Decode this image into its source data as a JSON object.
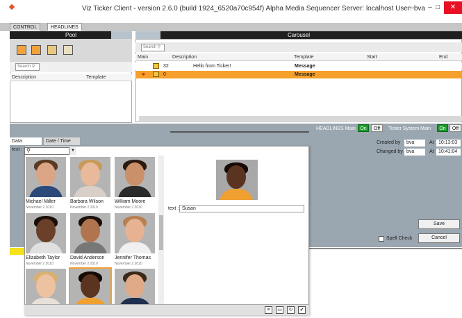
{
  "window": {
    "title": "Viz Ticker Client - version 2.6.0 (build 1924_6520a70c954f) Alpha    Media Sequencer Server: localhost   User: bva",
    "controls": [
      "↔",
      "–",
      "□",
      "✕"
    ]
  },
  "tabs": [
    "CONTROL",
    "HEADLINES"
  ],
  "pool": {
    "title": "Pool",
    "search_placeholder": "Search",
    "columns": [
      "Description",
      "Template"
    ]
  },
  "carousel": {
    "title": "Carousel",
    "search_placeholder": "Search",
    "columns": [
      "Main",
      "Description",
      "Template",
      "Start",
      "End"
    ],
    "rows": [
      {
        "count": "32",
        "description": "Hello from Ticker!",
        "template": "Message"
      },
      {
        "count": "0",
        "description": "",
        "template": "Message"
      }
    ]
  },
  "controls_bar": {
    "headlines_main_label": "HEADLINES Main",
    "ticker_main_label": "Ticker System Main",
    "on_label": "On",
    "off_label": "Off"
  },
  "editor": {
    "tabs": [
      "Data",
      "Date / Time"
    ],
    "field_label": "text :",
    "text_value": "Susan",
    "created_by_label": "Created by",
    "created_by": "bva",
    "changed_by_label": "Changed by",
    "changed_by": "bva",
    "at_label": "At",
    "created_at": "10:13:03",
    "changed_at": "10:41:04",
    "spell_check_label": "Spell Check",
    "save_label": "Save",
    "cancel_label": "Cancel"
  },
  "picker": {
    "images": [
      {
        "name": "Michael Miller",
        "date": "November 2 2010",
        "skin": "#d9a584",
        "hair": "#5a3a22",
        "shirt": "#2b4a7a"
      },
      {
        "name": "Barbara Wilson",
        "date": "November 2 2010",
        "skin": "#e8b99a",
        "hair": "#c79a5a",
        "shirt": "#d8d0c8"
      },
      {
        "name": "William Moore",
        "date": "November 2 2010",
        "skin": "#c9906a",
        "hair": "#2a1a10",
        "shirt": "#2a2a2a"
      },
      {
        "name": "Elizabeth Taylor",
        "date": "November 2 2010",
        "skin": "#6a4028",
        "hair": "#1a0e08",
        "shirt": "#e0e0e0"
      },
      {
        "name": "David Anderson",
        "date": "November 2 2010",
        "skin": "#b0754e",
        "hair": "#1a100a",
        "shirt": "#777777"
      },
      {
        "name": "Jennifer Thomas",
        "date": "November 2 2010",
        "skin": "#e6b292",
        "hair": "#b88050",
        "shirt": "#f0f0f0"
      },
      {
        "name": "",
        "date": "",
        "skin": "#ecc2a0",
        "hair": "#d8b070",
        "shirt": "#e8e0d8"
      },
      {
        "name": "",
        "date": "",
        "skin": "#5a3420",
        "hair": "#150a05",
        "shirt": "#f0a030"
      },
      {
        "name": "",
        "date": "",
        "skin": "#e0aa88",
        "hair": "#3a2818",
        "shirt": "#1f2f4f"
      }
    ]
  }
}
